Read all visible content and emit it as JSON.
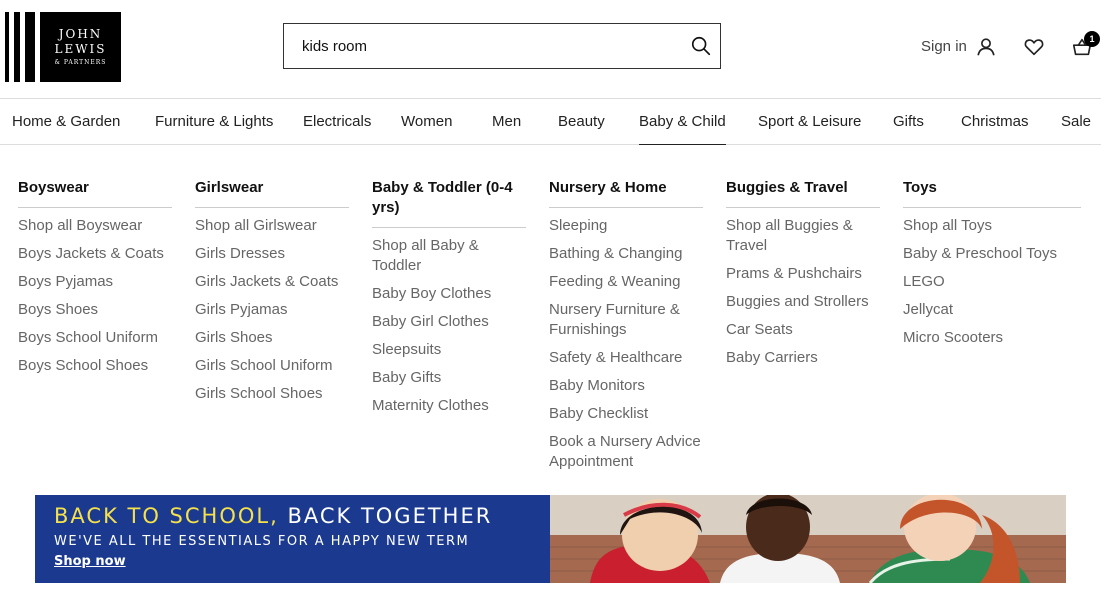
{
  "brand": {
    "line1": "JOHN",
    "line2": "LEWIS",
    "line3": "& PARTNERS"
  },
  "search": {
    "value": "kids room",
    "placeholder": "Search"
  },
  "header": {
    "sign_in": "Sign in",
    "basket_count": "1"
  },
  "nav": {
    "items": [
      {
        "label": "Home & Garden"
      },
      {
        "label": "Furniture & Lights"
      },
      {
        "label": "Electricals"
      },
      {
        "label": "Women"
      },
      {
        "label": "Men"
      },
      {
        "label": "Beauty"
      },
      {
        "label": "Baby & Child"
      },
      {
        "label": "Sport & Leisure"
      },
      {
        "label": "Gifts"
      },
      {
        "label": "Christmas"
      },
      {
        "label": "Sale"
      }
    ],
    "active": "Baby & Child"
  },
  "menu": {
    "columns": [
      {
        "heading": "Boyswear",
        "links": [
          "Shop all Boyswear",
          "Boys Jackets & Coats",
          "Boys Pyjamas",
          "Boys Shoes",
          "Boys School Uniform",
          "Boys School Shoes"
        ]
      },
      {
        "heading": "Girlswear",
        "links": [
          "Shop all Girlswear",
          "Girls Dresses",
          "Girls Jackets & Coats",
          "Girls Pyjamas",
          "Girls Shoes",
          "Girls School Uniform",
          "Girls School Shoes"
        ]
      },
      {
        "heading": "Baby & Toddler (0-4 yrs)",
        "links": [
          "Shop all Baby & Toddler",
          "Baby Boy Clothes",
          "Baby Girl Clothes",
          "Sleepsuits",
          "Baby Gifts",
          "Maternity Clothes"
        ]
      },
      {
        "heading": "Nursery & Home",
        "links": [
          "Sleeping",
          "Bathing & Changing",
          "Feeding & Weaning",
          "Nursery Furniture & Furnishings",
          "Safety & Healthcare",
          "Baby Monitors",
          "Baby Checklist",
          "Book a Nursery Advice Appointment"
        ]
      },
      {
        "heading": "Buggies & Travel",
        "links": [
          "Shop all Buggies & Travel",
          "Prams & Pushchairs",
          "Buggies and Strollers",
          "Car Seats",
          "Baby Carriers"
        ]
      },
      {
        "heading": "Toys",
        "links": [
          "Shop all Toys",
          "Baby & Preschool Toys",
          "LEGO",
          "Jellycat",
          "Micro Scooters"
        ]
      }
    ]
  },
  "banner": {
    "headline_yellow": "BACK TO SCHOOL,",
    "headline_white": " BACK TOGETHER",
    "subline": "WE'VE ALL THE ESSENTIALS FOR A HAPPY NEW TERM",
    "cta": "Shop now"
  },
  "colors": {
    "banner_blue": "#1b3a8f",
    "banner_yellow": "#f4e14b",
    "link_grey": "#666666",
    "text_dark": "#222222"
  },
  "icons": [
    "search-icon",
    "account-icon",
    "heart-icon",
    "basket-icon"
  ]
}
